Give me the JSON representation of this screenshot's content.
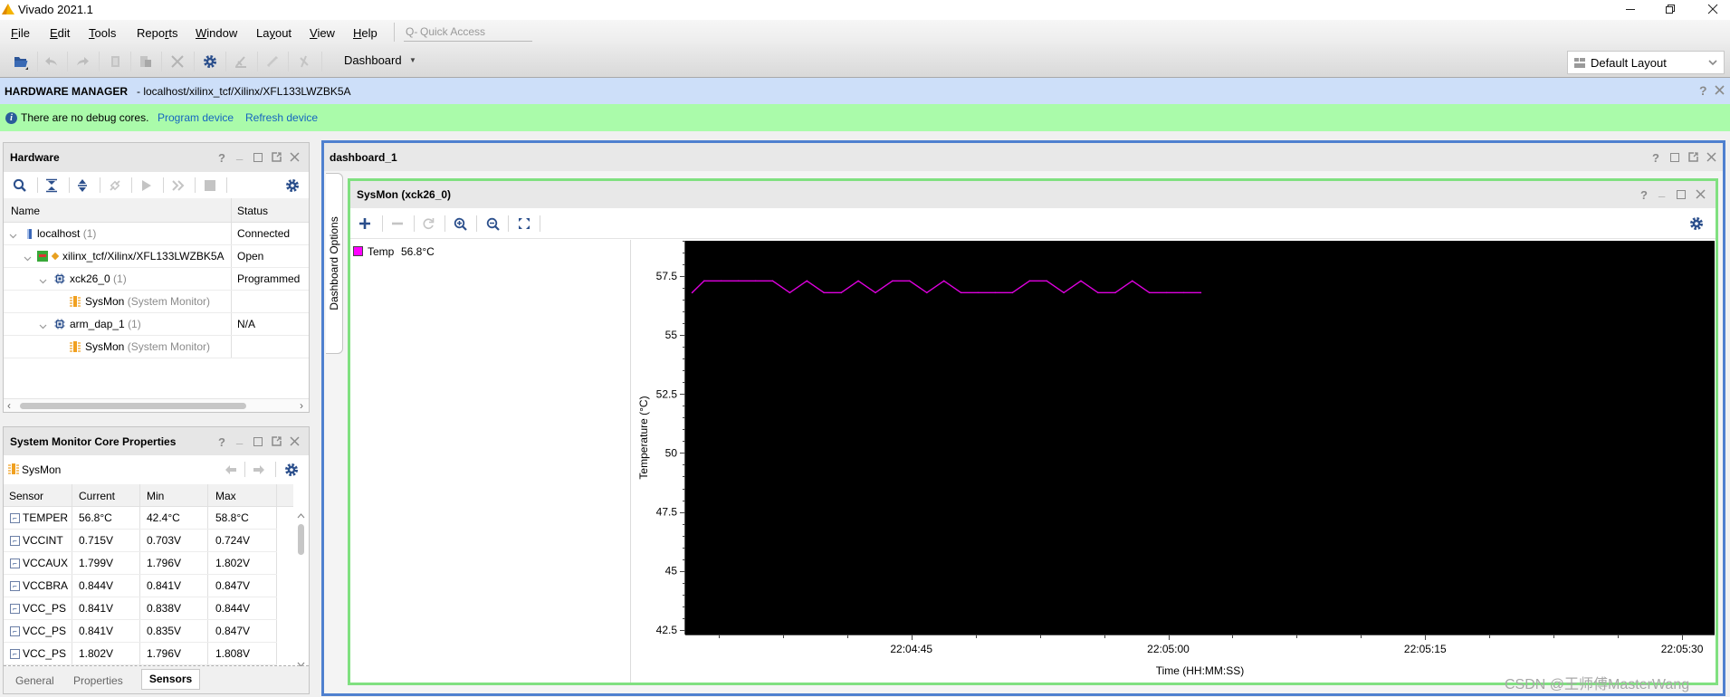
{
  "window": {
    "title": "Vivado 2021.1"
  },
  "menu": [
    {
      "label": "File",
      "mnemonic": 0
    },
    {
      "label": "Edit",
      "mnemonic": 0
    },
    {
      "label": "Tools",
      "mnemonic": 0
    },
    {
      "label": "Reports",
      "mnemonic": 4
    },
    {
      "label": "Window",
      "mnemonic": 0
    },
    {
      "label": "Layout",
      "mnemonic": 2
    },
    {
      "label": "View",
      "mnemonic": 0
    },
    {
      "label": "Help",
      "mnemonic": 0
    }
  ],
  "quick_access": {
    "placeholder": "Quick Access"
  },
  "toolbar": {
    "dashboard_label": "Dashboard",
    "layout_select": "Default Layout"
  },
  "hw_manager": {
    "title": "HARDWARE MANAGER",
    "path": " - localhost/xilinx_tcf/Xilinx/XFL133LWZBK5A"
  },
  "info_bar": {
    "message": "There are no debug cores.",
    "program_link": "Program device",
    "refresh_link": "Refresh device"
  },
  "hardware": {
    "title": "Hardware",
    "columns": {
      "name": "Name",
      "status": "Status"
    },
    "rows": [
      {
        "name": "localhost",
        "suffix": "(1)",
        "status": "Connected"
      },
      {
        "name": "xilinx_tcf/Xilinx/XFL133LWZBK5A",
        "suffix": "",
        "status": "Open"
      },
      {
        "name": "xck26_0",
        "suffix": "(1)",
        "status": "Programmed"
      },
      {
        "name": "SysMon",
        "suffix": "(System Monitor)",
        "status": ""
      },
      {
        "name": "arm_dap_1",
        "suffix": "(1)",
        "status": "N/A"
      },
      {
        "name": "SysMon",
        "suffix": "(System Monitor)",
        "status": ""
      }
    ]
  },
  "sysmon_props": {
    "title": "System Monitor Core Properties",
    "object": "SysMon",
    "columns": {
      "sensor": "Sensor",
      "current": "Current",
      "min": "Min",
      "max": "Max"
    },
    "rows": [
      {
        "sensor": "TEMPER",
        "current": "56.8°C",
        "min": "42.4°C",
        "max": "58.8°C"
      },
      {
        "sensor": "VCCINT",
        "current": "0.715V",
        "min": "0.703V",
        "max": "0.724V"
      },
      {
        "sensor": "VCCAUX",
        "current": "1.799V",
        "min": "1.796V",
        "max": "1.802V"
      },
      {
        "sensor": "VCCBRA",
        "current": "0.844V",
        "min": "0.841V",
        "max": "0.847V"
      },
      {
        "sensor": "VCC_PS",
        "current": "0.841V",
        "min": "0.838V",
        "max": "0.844V"
      },
      {
        "sensor": "VCC_PS",
        "current": "0.841V",
        "min": "0.835V",
        "max": "0.847V"
      },
      {
        "sensor": "VCC_PS",
        "current": "1.802V",
        "min": "1.796V",
        "max": "1.808V"
      }
    ],
    "tabs": [
      "General",
      "Properties",
      "Sensors"
    ],
    "active_tab": "Sensors"
  },
  "dashboard": {
    "title": "dashboard_1",
    "options_tab": "Dashboard Options",
    "panel_title": "SysMon (xck26_0)",
    "legend": [
      {
        "name": "Temp",
        "value": "56.8°C",
        "color": "#ff00ff"
      }
    ]
  },
  "colors": {
    "dashboard_border": "#4f80cf",
    "panel_border": "#80e080",
    "info_bar": "#aafbaa",
    "header_bar": "#cddff9"
  },
  "chart_data": {
    "type": "line",
    "title": "SysMon (xck26_0)",
    "xlabel": "Time (HH:MM:SS)",
    "ylabel": "Temperature (°C)",
    "xlim": [
      "22:04:31.8",
      "22:05:31.9"
    ],
    "ylim": [
      42.3,
      59.0
    ],
    "x_ticks": [
      "22:04:45",
      "22:05:00",
      "22:05:15",
      "22:05:30"
    ],
    "x_minor_tick_interval_s": 3.75,
    "y_ticks": [
      42.5,
      45,
      47.5,
      50,
      52.5,
      55,
      57.5
    ],
    "y_minor_tick_interval": 0.5,
    "grid": false,
    "legend": "top-left",
    "plot_background": "#000000",
    "series": [
      {
        "name": "Temp",
        "color": "#e000e0",
        "x": [
          "22:04:32.2",
          "22:04:32.9",
          "22:04:33.9",
          "22:04:34.9",
          "22:04:35.9",
          "22:04:36.9",
          "22:04:37.9",
          "22:04:38.9",
          "22:04:39.9",
          "22:04:40.9",
          "22:04:41.9",
          "22:04:42.9",
          "22:04:43.9",
          "22:04:44.9",
          "22:04:45.9",
          "22:04:46.9",
          "22:04:47.9",
          "22:04:48.9",
          "22:04:49.9",
          "22:04:50.9",
          "22:04:51.9",
          "22:04:52.9",
          "22:04:53.9",
          "22:04:54.9",
          "22:04:55.9",
          "22:04:56.9",
          "22:04:57.9",
          "22:04:58.9",
          "22:04:59.9",
          "22:05:00.9",
          "22:05:01.9"
        ],
        "y": [
          56.8,
          57.3,
          57.3,
          57.3,
          57.3,
          57.3,
          56.8,
          57.3,
          56.8,
          56.8,
          57.3,
          56.8,
          57.3,
          57.3,
          56.8,
          57.3,
          56.8,
          56.8,
          56.8,
          56.8,
          57.3,
          57.3,
          56.8,
          57.3,
          56.8,
          56.8,
          57.3,
          56.8,
          56.8,
          56.8,
          56.8
        ]
      }
    ]
  },
  "watermark": "CSDN @王师傅MasterWang"
}
